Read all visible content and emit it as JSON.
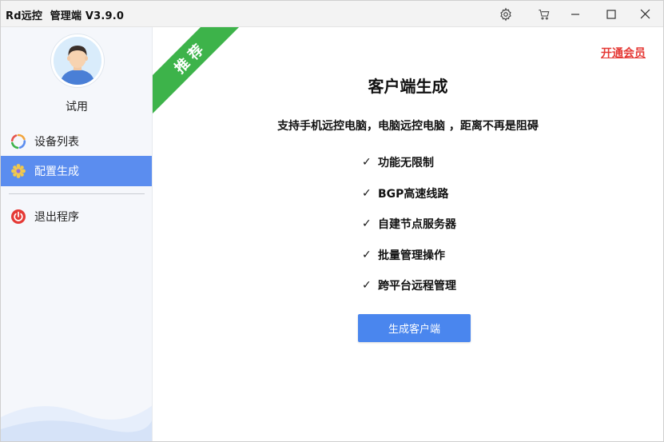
{
  "window": {
    "title": "Rd远控  管理端 V3.9.0"
  },
  "titlebar": {
    "icons": [
      "gear-icon",
      "cart-icon",
      "minimize-icon",
      "maximize-icon",
      "close-icon"
    ]
  },
  "sidebar": {
    "username": "试用",
    "items": [
      {
        "label": "设备列表",
        "icon": "device-list-icon",
        "active": false
      },
      {
        "label": "配置生成",
        "icon": "gear-flower-icon",
        "active": true
      },
      {
        "label": "退出程序",
        "icon": "power-icon",
        "active": false
      }
    ]
  },
  "main": {
    "ribbon": "推荐",
    "vip_link": "开通会员",
    "heading": "客户端生成",
    "subtitle": "支持手机远控电脑，电脑远控电脑 ，距离不再是阻碍",
    "check_mark": "✓",
    "features": [
      "功能无限制",
      "BGP高速线路",
      "自建节点服务器",
      "批量管理操作",
      "跨平台远程管理"
    ],
    "generate_button": "生成客户端"
  },
  "colors": {
    "accent": "#5b8def",
    "button": "#4a86ee",
    "ribbon": "#3db34a",
    "vip": "#e53935",
    "power": "#e53935"
  }
}
